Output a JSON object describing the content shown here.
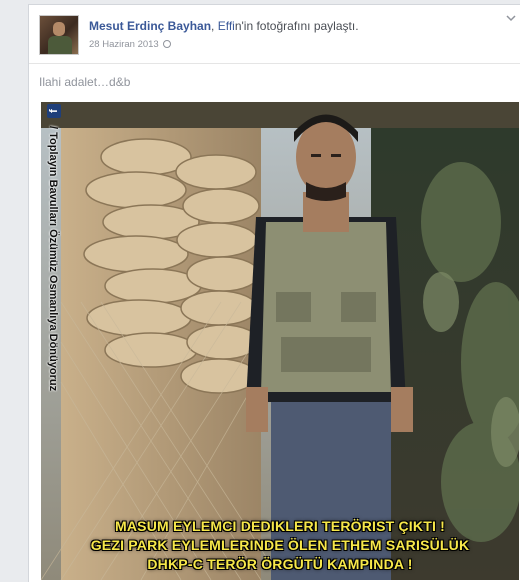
{
  "post": {
    "author": "Mesut Erdinç Bayhan",
    "shared_prefix": ", ",
    "friend": "Effi",
    "shared_suffix": "n'in fotoğrafını paylaştı.",
    "date": "28 Haziran 2013",
    "status_text": "Ilahi adalet…d&b",
    "link_color": "#3b5998"
  },
  "photo": {
    "watermark": "/ Toplayın Bavulları Özümüz Osmanlıya Dönüyoruz",
    "watermark_icon": "facebook-logo-icon",
    "caption_line_1": "MASUM EYLEMCI DEDIKLERI TERÖRIST ÇIKTI !",
    "caption_line_2": "GEZI PARK EYLEMLERINDE ÖLEN ETHEM SARISÜLÜK",
    "caption_line_3": "DHKP-C TERÖR ÖRGÜTÜ KAMPINDA !",
    "caption_color": "#f7e84a"
  }
}
